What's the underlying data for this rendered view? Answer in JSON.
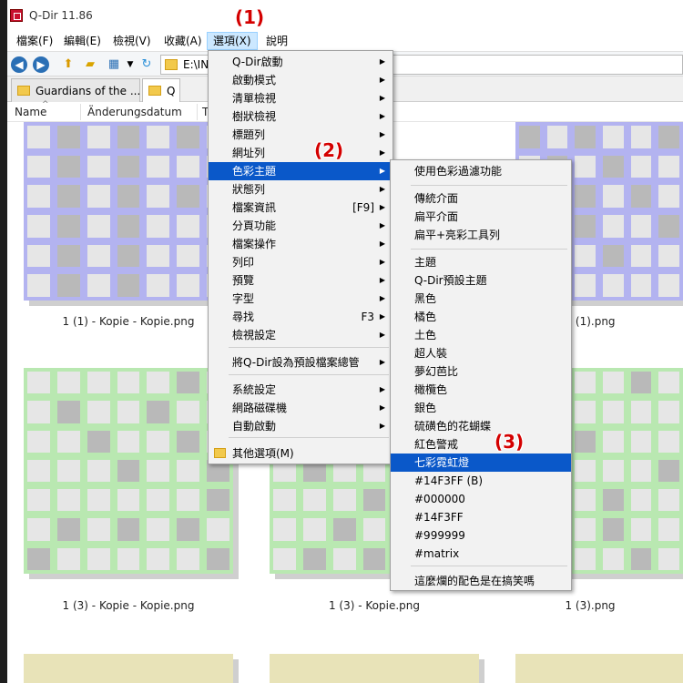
{
  "window": {
    "title": "Q-Dir 11.86"
  },
  "menubar": {
    "items": [
      "檔案(F)",
      "編輯(E)",
      "檢視(V)",
      "收藏(A)",
      "選項(X)",
      "說明"
    ]
  },
  "toolbar": {
    "address": "E:\\INI"
  },
  "tabs": [
    "Guardians of the ...",
    "Q"
  ],
  "columns": [
    "Name",
    "Änderungsdatum",
    "T"
  ],
  "files": [
    "1 (1) - Kopie - Kopie.png",
    "1 (1).png",
    "1 (3) - Kopie - Kopie.png",
    "1 (3) - Kopie.png",
    "1 (3).png"
  ],
  "options_menu": {
    "items": [
      {
        "label": "Q-Dir啟動",
        "shortcut": "",
        "submenu": true
      },
      {
        "label": "啟動模式",
        "shortcut": "",
        "submenu": true
      },
      {
        "label": "清單檢視",
        "shortcut": "",
        "submenu": true
      },
      {
        "label": "樹狀檢視",
        "shortcut": "",
        "submenu": true
      },
      {
        "label": "標題列",
        "shortcut": "",
        "submenu": true
      },
      {
        "label": "網址列",
        "shortcut": "",
        "submenu": true
      },
      {
        "label": "色彩主題",
        "shortcut": "",
        "submenu": true
      },
      {
        "label": "狀態列",
        "shortcut": "",
        "submenu": true
      },
      {
        "label": "檔案資訊",
        "shortcut": "[F9]",
        "submenu": true
      },
      {
        "label": "分頁功能",
        "shortcut": "",
        "submenu": true
      },
      {
        "label": "檔案操作",
        "shortcut": "",
        "submenu": true
      },
      {
        "label": "列印",
        "shortcut": "",
        "submenu": true
      },
      {
        "label": "預覽",
        "shortcut": "",
        "submenu": true
      },
      {
        "label": "字型",
        "shortcut": "",
        "submenu": true
      },
      {
        "label": "尋找",
        "shortcut": "F3",
        "submenu": true
      },
      {
        "label": "檢視設定",
        "shortcut": "",
        "submenu": true
      },
      {
        "label": "將Q-Dir設為預設檔案總管",
        "shortcut": "",
        "submenu": true
      },
      {
        "label": "系統設定",
        "shortcut": "",
        "submenu": true
      },
      {
        "label": "網路磁碟機",
        "shortcut": "",
        "submenu": true
      },
      {
        "label": "自動啟動",
        "shortcut": "",
        "submenu": true
      },
      {
        "label": "其他選項(M)",
        "shortcut": "",
        "submenu": false
      }
    ]
  },
  "theme_submenu": {
    "items": [
      "使用色彩過濾功能",
      "傳統介面",
      "扁平介面",
      "扁平+亮彩工具列",
      "主題",
      "Q-Dir預設主題",
      "黑色",
      "橘色",
      "土色",
      "超人裝",
      "夢幻芭比",
      "橄欖色",
      "銀色",
      "硫磺色的花蝴蝶",
      "紅色警戒",
      "七彩霓虹燈",
      "#14F3FF (B)",
      "#000000",
      "#14F3FF",
      "#999999",
      "#matrix",
      "這麼爛的配色是在搞笑嗎"
    ]
  },
  "callouts": [
    "(1)",
    "(2)",
    "(3)"
  ],
  "colors": {
    "highlight": "#0a58c9",
    "menu_active": "#cce8ff",
    "callout": "#d40000",
    "thumb_purple": "#b3b3f0",
    "thumb_green": "#b9e8b1",
    "thumb_yellow": "#e8e3b8"
  }
}
